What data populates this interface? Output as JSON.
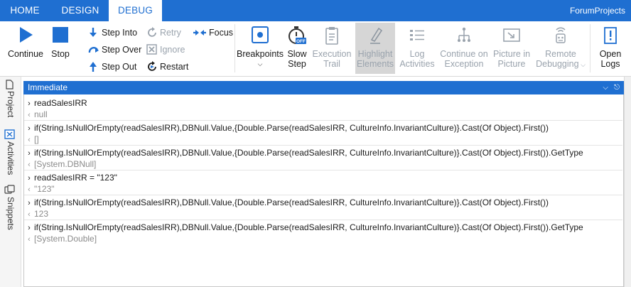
{
  "tabs": [
    {
      "label": "HOME",
      "active": false
    },
    {
      "label": "DESIGN",
      "active": false
    },
    {
      "label": "DEBUG",
      "active": true
    }
  ],
  "project_name": "ForumProjects",
  "ribbon": {
    "continue": "Continue",
    "stop": "Stop",
    "step_into": "Step Into",
    "step_over": "Step Over",
    "step_out": "Step Out",
    "retry": "Retry",
    "ignore": "Ignore",
    "restart": "Restart",
    "focus": "Focus",
    "breakpoints": "Breakpoints",
    "slow_step": [
      "Slow",
      "Step"
    ],
    "slow_step_badge": "OFF",
    "execution_trail": [
      "Execution",
      "Trail"
    ],
    "highlight_elements": [
      "Highlight",
      "Elements"
    ],
    "log_activities": [
      "Log",
      "Activities"
    ],
    "continue_on_exception": [
      "Continue on",
      "Exception"
    ],
    "picture_in_picture": [
      "Picture in",
      "Picture"
    ],
    "remote_debugging": [
      "Remote",
      "Debugging"
    ],
    "open_logs": [
      "Open",
      "Logs"
    ]
  },
  "sidebar": [
    "Project",
    "Activities",
    "Snippets"
  ],
  "panel": {
    "title": "Immediate",
    "entries": [
      {
        "input": "readSalesIRR",
        "output": "null"
      },
      {
        "input": "if(String.IsNullOrEmpty(readSalesIRR),DBNull.Value,{Double.Parse(readSalesIRR, CultureInfo.InvariantCulture)}.Cast(Of Object).First())",
        "output": "[]"
      },
      {
        "input": "if(String.IsNullOrEmpty(readSalesIRR),DBNull.Value,{Double.Parse(readSalesIRR, CultureInfo.InvariantCulture)}.Cast(Of Object).First()).GetType",
        "output": "[System.DBNull]"
      },
      {
        "input": "readSalesIRR = \"123\"",
        "output": "\"123\""
      },
      {
        "input": "if(String.IsNullOrEmpty(readSalesIRR),DBNull.Value,{Double.Parse(readSalesIRR, CultureInfo.InvariantCulture)}.Cast(Of Object).First())",
        "output": "123"
      },
      {
        "input": "if(String.IsNullOrEmpty(readSalesIRR),DBNull.Value,{Double.Parse(readSalesIRR, CultureInfo.InvariantCulture)}.Cast(Of Object).First()).GetType",
        "output": "[System.Double]"
      }
    ]
  },
  "colors": {
    "accent": "#1f6fd1",
    "disabled": "#9aa3ad",
    "highlight_bg": "#d6d6d6"
  }
}
